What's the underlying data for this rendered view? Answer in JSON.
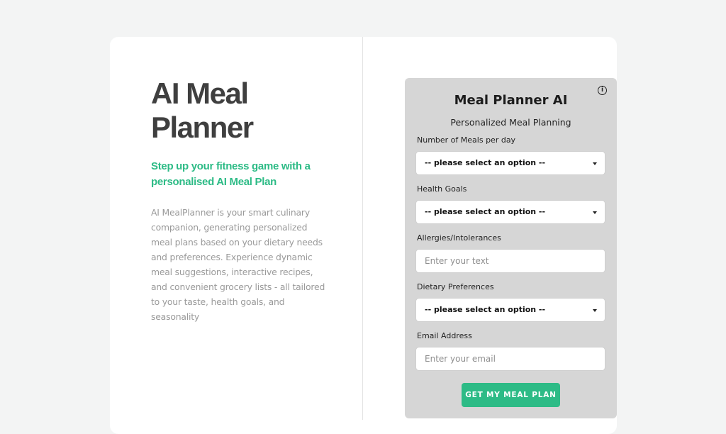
{
  "hero": {
    "title": "AI Meal Planner",
    "subtitle": "Step up your fitness game with a personalised AI Meal Plan",
    "description": "AI MealPlanner is your smart culinary companion, generating personalized meal plans based on your dietary needs and preferences. Experience dynamic meal suggestions, interactive recipes, and convenient grocery lists - all tailored to your taste, health goals, and seasonality"
  },
  "form": {
    "info_icon": "i",
    "title": "Meal Planner AI",
    "subtitle": "Personalized Meal Planning",
    "meals": {
      "label": "Number of Meals per day",
      "value": "-- please select an option --"
    },
    "goals": {
      "label": "Health Goals",
      "value": "-- please select an option --"
    },
    "allergies": {
      "label": "Allergies/Intolerances",
      "placeholder": "Enter your text"
    },
    "diet": {
      "label": "Dietary Preferences",
      "value": "-- please select an option --"
    },
    "email": {
      "label": "Email Address",
      "placeholder": "Enter your email"
    },
    "submit_label": "GET MY MEAL PLAN"
  },
  "colors": {
    "accent": "#2dbb86",
    "page_background": "#f3f4f4",
    "panel_background": "#d6d6d6"
  }
}
